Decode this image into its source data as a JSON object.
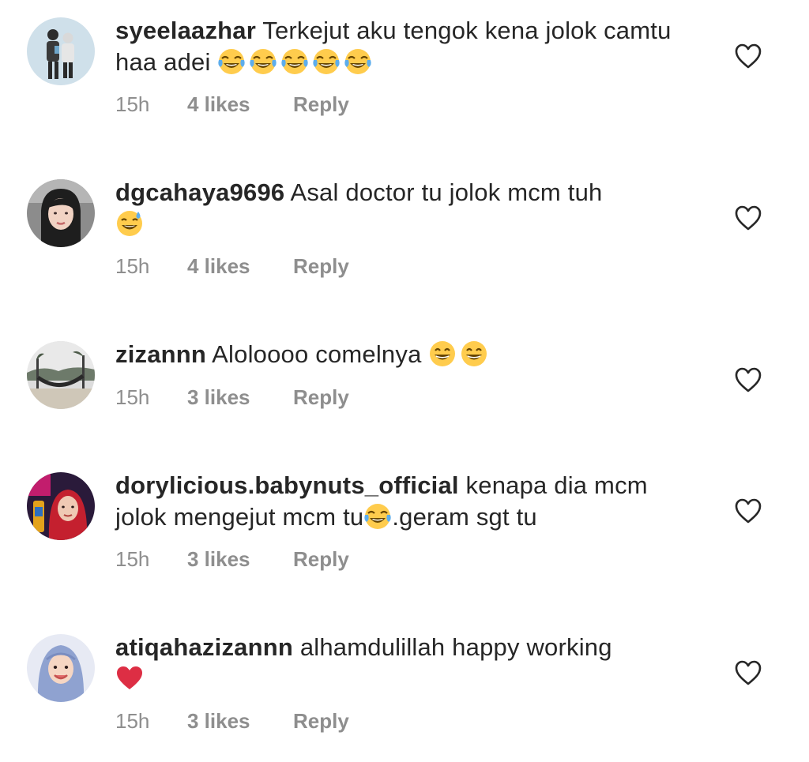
{
  "colors": {
    "text": "#262626",
    "meta": "#8e8e8e",
    "heart_outline": "#262626"
  },
  "comments": [
    {
      "username": "syeelaazhar",
      "body": "Terkejut aku tengok kena jolok camtu haa adei",
      "emoji": [
        "face-with-tears-of-joy",
        "face-with-tears-of-joy",
        "face-with-tears-of-joy",
        "face-with-tears-of-joy",
        "face-with-tears-of-joy"
      ],
      "time": "15h",
      "likes": "4 likes",
      "reply": "Reply",
      "avatar_icon": "couple-illustration-avatar"
    },
    {
      "username": "dgcahaya9696",
      "body": "Asal doctor tu jolok mcm tuh",
      "emoji": [
        "grinning-face-with-sweat"
      ],
      "time": "15h",
      "likes": "4 likes",
      "reply": "Reply",
      "avatar_icon": "woman-selfie-avatar"
    },
    {
      "username": "zizannn",
      "body": "Aloloooo comelnya",
      "emoji": [
        "grinning-face-with-smiling-eyes",
        "grinning-face-with-smiling-eyes"
      ],
      "time": "15h",
      "likes": "3 likes",
      "reply": "Reply",
      "avatar_icon": "beach-hammock-avatar"
    },
    {
      "username": "dorylicious.babynuts_official",
      "body_before": "kenapa dia mcm jolok mengejut mcm tu",
      "emoji": [
        "face-with-tears-of-joy"
      ],
      "body_after": ".geram sgt tu",
      "time": "15h",
      "likes": "3 likes",
      "reply": "Reply",
      "avatar_icon": "woman-hijab-red-avatar"
    },
    {
      "username": "atiqahazizannn",
      "body": "alhamdulillah happy working",
      "emoji": [
        "red-heart"
      ],
      "time": "15h",
      "likes": "3 likes",
      "reply": "Reply",
      "avatar_icon": "woman-hijab-blue-avatar"
    }
  ]
}
